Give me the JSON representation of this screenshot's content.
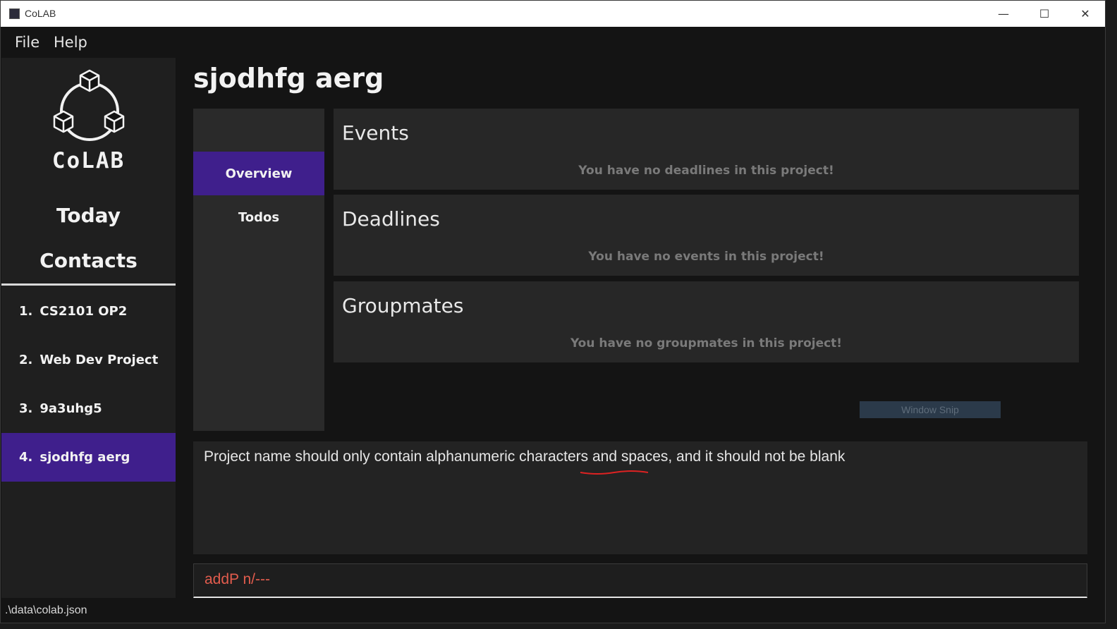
{
  "window": {
    "title": "CoLAB",
    "controls": {
      "minimize": "—",
      "maximize": "☐",
      "close": "✕"
    }
  },
  "menubar": {
    "file": "File",
    "help": "Help"
  },
  "sidebar": {
    "logo_text": "CoLAB",
    "nav": {
      "today": "Today",
      "contacts": "Contacts"
    },
    "projects": [
      {
        "num": "1.",
        "name": "CS2101 OP2"
      },
      {
        "num": "2.",
        "name": "Web Dev Project"
      },
      {
        "num": "3.",
        "name": "9a3uhg5"
      },
      {
        "num": "4.",
        "name": "sjodhfg aerg"
      }
    ]
  },
  "main": {
    "title": "sjodhfg aerg",
    "tabs": [
      {
        "label": "Overview"
      },
      {
        "label": "Todos"
      }
    ],
    "sections": [
      {
        "title": "Events",
        "empty": "You have no deadlines in this project!"
      },
      {
        "title": "Deadlines",
        "empty": "You have no events in this project!"
      },
      {
        "title": "Groupmates",
        "empty": "You have no groupmates in this project!"
      }
    ],
    "snip_label": "Window Snip"
  },
  "result": {
    "message": "Project name should only contain alphanumeric characters and spaces, and it should not be blank"
  },
  "command": {
    "value": "addP n/---"
  },
  "status": {
    "path": ".\\data\\colab.json"
  },
  "colors": {
    "accent": "#3f1f8c",
    "error_text": "#e25c4d"
  }
}
